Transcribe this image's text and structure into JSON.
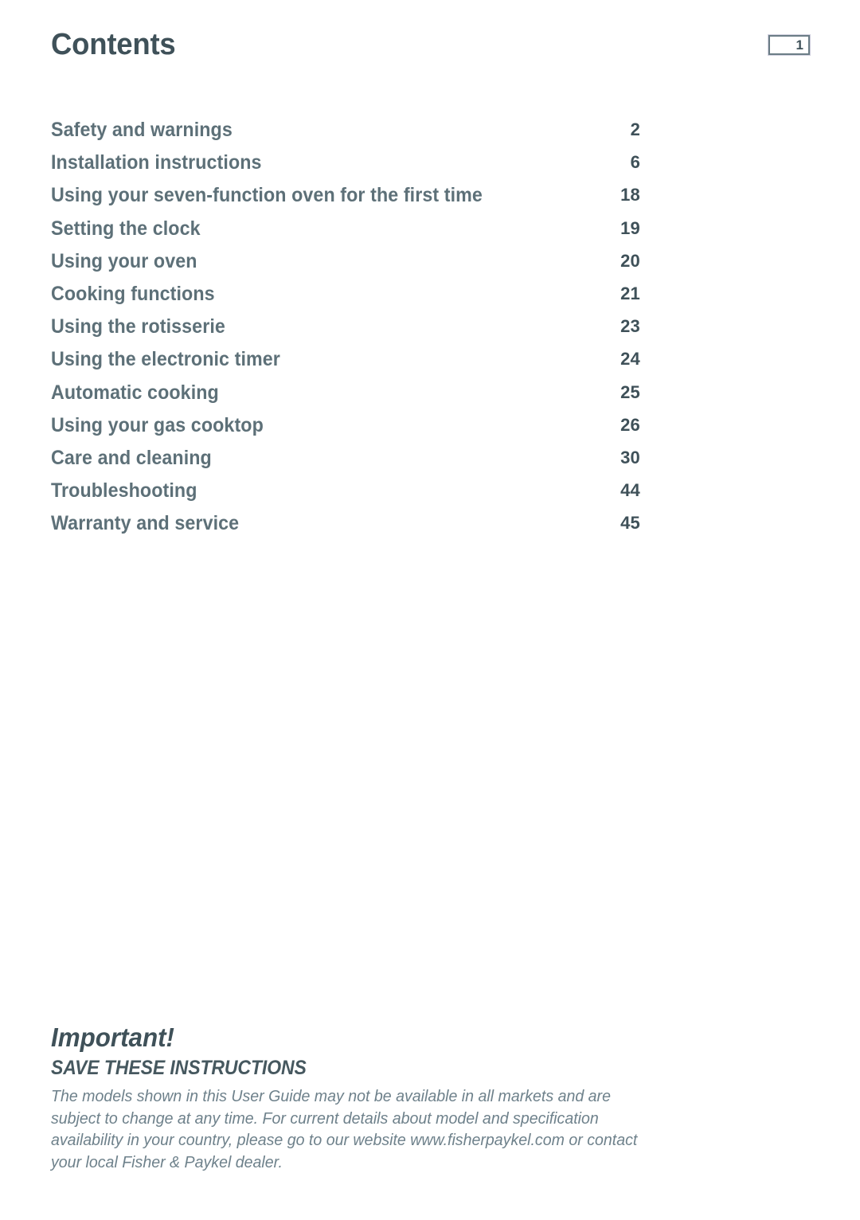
{
  "header": {
    "title": "Contents",
    "page_number": "1"
  },
  "toc": {
    "entries": [
      {
        "label": "Safety and warnings",
        "page": "2"
      },
      {
        "label": "Installation instructions",
        "page": "6"
      },
      {
        "label": "Using your seven-function oven for the first time",
        "page": "18"
      },
      {
        "label": "Setting the clock",
        "page": "19"
      },
      {
        "label": "Using your oven",
        "page": "20"
      },
      {
        "label": "Cooking functions",
        "page": "21"
      },
      {
        "label": "Using the rotisserie",
        "page": "23"
      },
      {
        "label": "Using the electronic timer",
        "page": "24"
      },
      {
        "label": "Automatic cooking",
        "page": "25"
      },
      {
        "label": "Using your gas cooktop",
        "page": "26"
      },
      {
        "label": "Care and cleaning",
        "page": "30"
      },
      {
        "label": "Troubleshooting",
        "page": "44"
      },
      {
        "label": "Warranty and service",
        "page": "45"
      }
    ]
  },
  "footer": {
    "important_heading": "Important!",
    "save_instructions": "SAVE THESE INSTRUCTIONS",
    "disclaimer": "The models shown in this User Guide may not be available in all markets and are subject to change at any time. For current details about model and specification availability in your country, please go to our website www.fisherpaykel.com or contact your local Fisher & Paykel dealer."
  },
  "colors": {
    "heading": "#3f5159",
    "toc_label": "#5d7078",
    "toc_page": "#3f5159",
    "body_text": "#6e818b",
    "box_border": "#6b7d86",
    "background": "#ffffff"
  }
}
